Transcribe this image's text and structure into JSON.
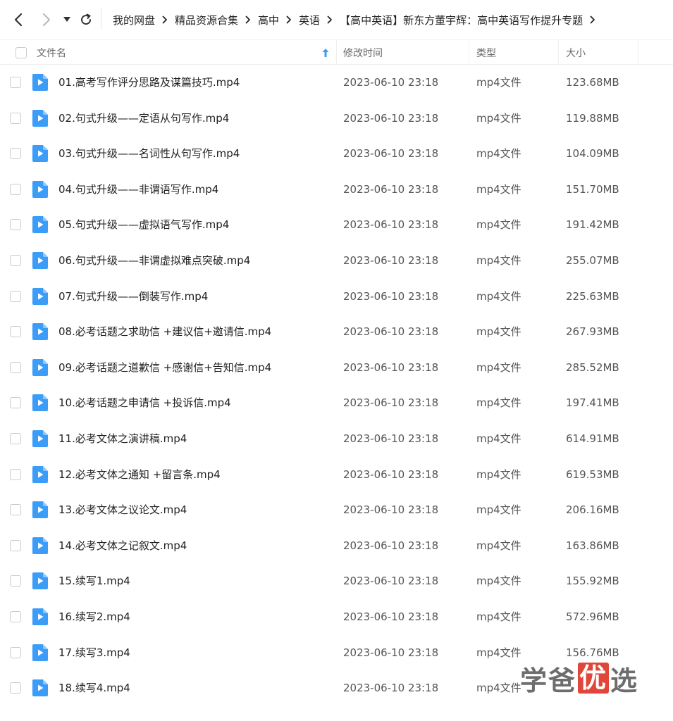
{
  "breadcrumb": [
    "我的网盘",
    "精品资源合集",
    "高中",
    "英语",
    "【高中英语】新东方董宇辉：高中英语写作提升专题"
  ],
  "header": {
    "name": "文件名",
    "modified": "修改时间",
    "type": "类型",
    "size": "大小"
  },
  "colors": {
    "file_icon": "#3b9df8",
    "sort_arrow": "#3b9df8",
    "watermark_accent": "#e0463a"
  },
  "files": [
    {
      "name": "01.高考写作评分思路及谋篇技巧.mp4",
      "modified": "2023-06-10 23:18",
      "type": "mp4文件",
      "size": "123.68MB"
    },
    {
      "name": "02.句式升级——定语从句写作.mp4",
      "modified": "2023-06-10 23:18",
      "type": "mp4文件",
      "size": "119.88MB"
    },
    {
      "name": "03.句式升级——名词性从句写作.mp4",
      "modified": "2023-06-10 23:18",
      "type": "mp4文件",
      "size": "104.09MB"
    },
    {
      "name": "04.句式升级——非谓语写作.mp4",
      "modified": "2023-06-10 23:18",
      "type": "mp4文件",
      "size": "151.70MB"
    },
    {
      "name": "05.句式升级——虚拟语气写作.mp4",
      "modified": "2023-06-10 23:18",
      "type": "mp4文件",
      "size": "191.42MB"
    },
    {
      "name": "06.句式升级——非谓虚拟难点突破.mp4",
      "modified": "2023-06-10 23:18",
      "type": "mp4文件",
      "size": "255.07MB"
    },
    {
      "name": "07.句式升级——倒装写作.mp4",
      "modified": "2023-06-10 23:18",
      "type": "mp4文件",
      "size": "225.63MB"
    },
    {
      "name": "08.必考话题之求助信 +建议信+邀请信.mp4",
      "modified": "2023-06-10 23:18",
      "type": "mp4文件",
      "size": "267.93MB"
    },
    {
      "name": "09.必考话题之道歉信 +感谢信+告知信.mp4",
      "modified": "2023-06-10 23:18",
      "type": "mp4文件",
      "size": "285.52MB"
    },
    {
      "name": "10.必考话题之申请信 +投诉信.mp4",
      "modified": "2023-06-10 23:18",
      "type": "mp4文件",
      "size": "197.41MB"
    },
    {
      "name": "11.必考文体之演讲稿.mp4",
      "modified": "2023-06-10 23:18",
      "type": "mp4文件",
      "size": "614.91MB"
    },
    {
      "name": "12.必考文体之通知 +留言条.mp4",
      "modified": "2023-06-10 23:18",
      "type": "mp4文件",
      "size": "619.53MB"
    },
    {
      "name": "13.必考文体之议论文.mp4",
      "modified": "2023-06-10 23:18",
      "type": "mp4文件",
      "size": "206.16MB"
    },
    {
      "name": "14.必考文体之记叙文.mp4",
      "modified": "2023-06-10 23:18",
      "type": "mp4文件",
      "size": "163.86MB"
    },
    {
      "name": "15.续写1.mp4",
      "modified": "2023-06-10 23:18",
      "type": "mp4文件",
      "size": "155.92MB"
    },
    {
      "name": "16.续写2.mp4",
      "modified": "2023-06-10 23:18",
      "type": "mp4文件",
      "size": "572.96MB"
    },
    {
      "name": "17.续写3.mp4",
      "modified": "2023-06-10 23:18",
      "type": "mp4文件",
      "size": "156.76MB"
    },
    {
      "name": "18.续写4.mp4",
      "modified": "2023-06-10 23:18",
      "type": "mp4文件",
      "size": ""
    }
  ],
  "watermark": {
    "part1": "学爸",
    "part2": "优",
    "part3": "选"
  }
}
